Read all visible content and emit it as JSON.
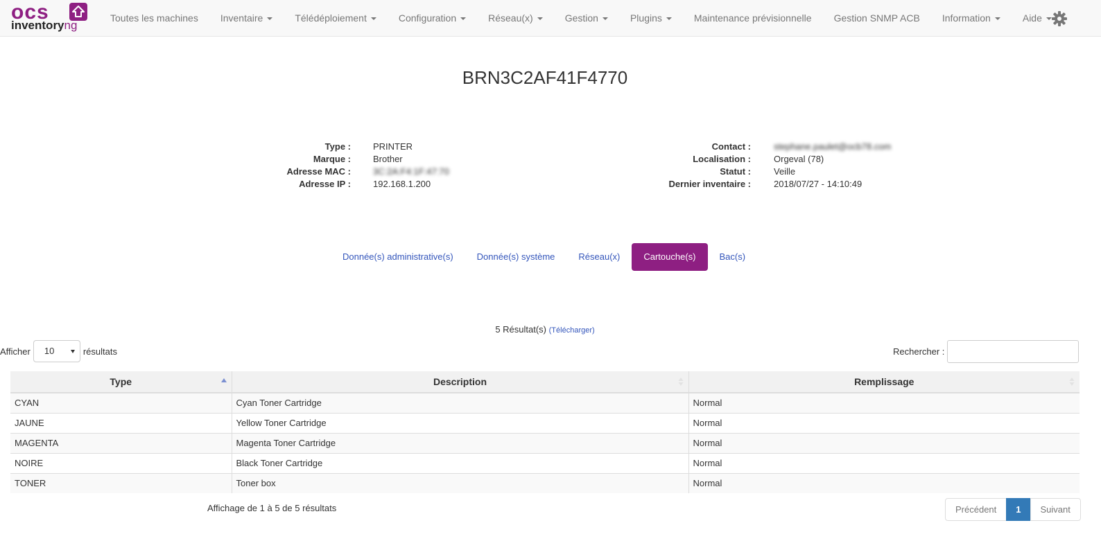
{
  "brand": {
    "logo_top": "ocs",
    "logo_bottom": "inventory",
    "logo_suffix": "ng",
    "color": "#8e1f82"
  },
  "nav": {
    "items": [
      {
        "label": "Toutes les machines",
        "dropdown": false
      },
      {
        "label": "Inventaire",
        "dropdown": true
      },
      {
        "label": "Télédéploiement",
        "dropdown": true
      },
      {
        "label": "Configuration",
        "dropdown": true
      },
      {
        "label": "Réseau(x)",
        "dropdown": true
      },
      {
        "label": "Gestion",
        "dropdown": true
      },
      {
        "label": "Plugins",
        "dropdown": true
      },
      {
        "label": "Maintenance prévisionnelle",
        "dropdown": false
      },
      {
        "label": "Gestion SNMP ACB",
        "dropdown": false
      },
      {
        "label": "Information",
        "dropdown": true
      },
      {
        "label": "Aide",
        "dropdown": true
      }
    ],
    "settings_icon": "gear-icon"
  },
  "page": {
    "title": "BRN3C2AF41F4770"
  },
  "summary": {
    "left": [
      {
        "label": "Type :",
        "value": "PRINTER"
      },
      {
        "label": "Marque :",
        "value": "Brother"
      },
      {
        "label": "Adresse MAC :",
        "value": "3C:2A:F4:1F:47:70"
      },
      {
        "label": "Adresse IP :",
        "value": "192.168.1.200"
      }
    ],
    "right": [
      {
        "label": "Contact :",
        "value": "stephane.paulet@ocb78.com"
      },
      {
        "label": "Localisation :",
        "value": "Orgeval (78)"
      },
      {
        "label": "Statut :",
        "value": "Veille"
      },
      {
        "label": "Dernier inventaire :",
        "value": "2018/07/27 - 14:10:49"
      }
    ]
  },
  "tabs": [
    {
      "label": "Donnée(s) administrative(s)",
      "active": false
    },
    {
      "label": "Donnée(s) système",
      "active": false
    },
    {
      "label": "Réseau(x)",
      "active": false
    },
    {
      "label": "Cartouche(s)",
      "active": true
    },
    {
      "label": "Bac(s)",
      "active": false
    }
  ],
  "results": {
    "count_text": "5 Résultat(s)",
    "download_label": "(Télécharger)"
  },
  "length": {
    "prefix": "Afficher",
    "value": "10",
    "suffix": "résultats"
  },
  "search": {
    "label": "Rechercher :",
    "value": ""
  },
  "table": {
    "columns": [
      "Type",
      "Description",
      "Remplissage"
    ],
    "rows": [
      [
        "CYAN",
        "Cyan Toner Cartridge",
        "Normal"
      ],
      [
        "JAUNE",
        "Yellow Toner Cartridge",
        "Normal"
      ],
      [
        "MAGENTA",
        "Magenta Toner Cartridge",
        "Normal"
      ],
      [
        "NOIRE",
        "Black Toner Cartridge",
        "Normal"
      ],
      [
        "TONER",
        "Toner box",
        "Normal"
      ]
    ]
  },
  "footer": {
    "info": "Affichage de 1 à 5 de 5 résultats",
    "pagination": {
      "prev": "Précédent",
      "current": "1",
      "next": "Suivant"
    }
  }
}
